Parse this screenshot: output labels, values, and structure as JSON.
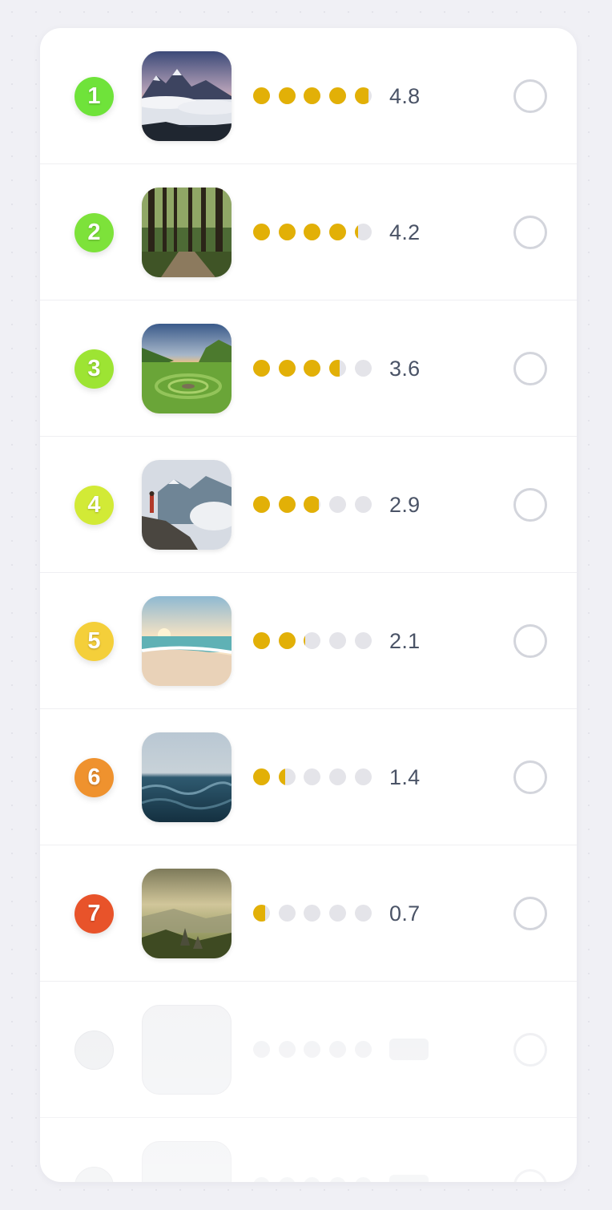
{
  "rating_colors": {
    "filled": "#e2b007",
    "empty": "#e4e4e9"
  },
  "items": [
    {
      "rank": "1",
      "rank_color": "#6fe33a",
      "image": "mountain-sea-of-clouds",
      "rating": 4.8,
      "score": "4.8"
    },
    {
      "rank": "2",
      "rank_color": "#7de23a",
      "image": "forest-path",
      "rating": 4.2,
      "score": "4.2"
    },
    {
      "rank": "3",
      "rank_color": "#9de433",
      "image": "green-valley-sunset",
      "rating": 3.6,
      "score": "3.6"
    },
    {
      "rank": "4",
      "rank_color": "#d2ea36",
      "image": "hiker-on-cliff",
      "rating": 2.9,
      "score": "2.9"
    },
    {
      "rank": "5",
      "rank_color": "#f4cf3a",
      "image": "beach-sunset",
      "rating": 2.1,
      "score": "2.1"
    },
    {
      "rank": "6",
      "rank_color": "#ef922e",
      "image": "ocean-waves",
      "rating": 1.4,
      "score": "1.4"
    },
    {
      "rank": "7",
      "rank_color": "#e8532a",
      "image": "misty-hills",
      "rating": 0.7,
      "score": "0.7"
    }
  ],
  "skeleton_rows": 2
}
